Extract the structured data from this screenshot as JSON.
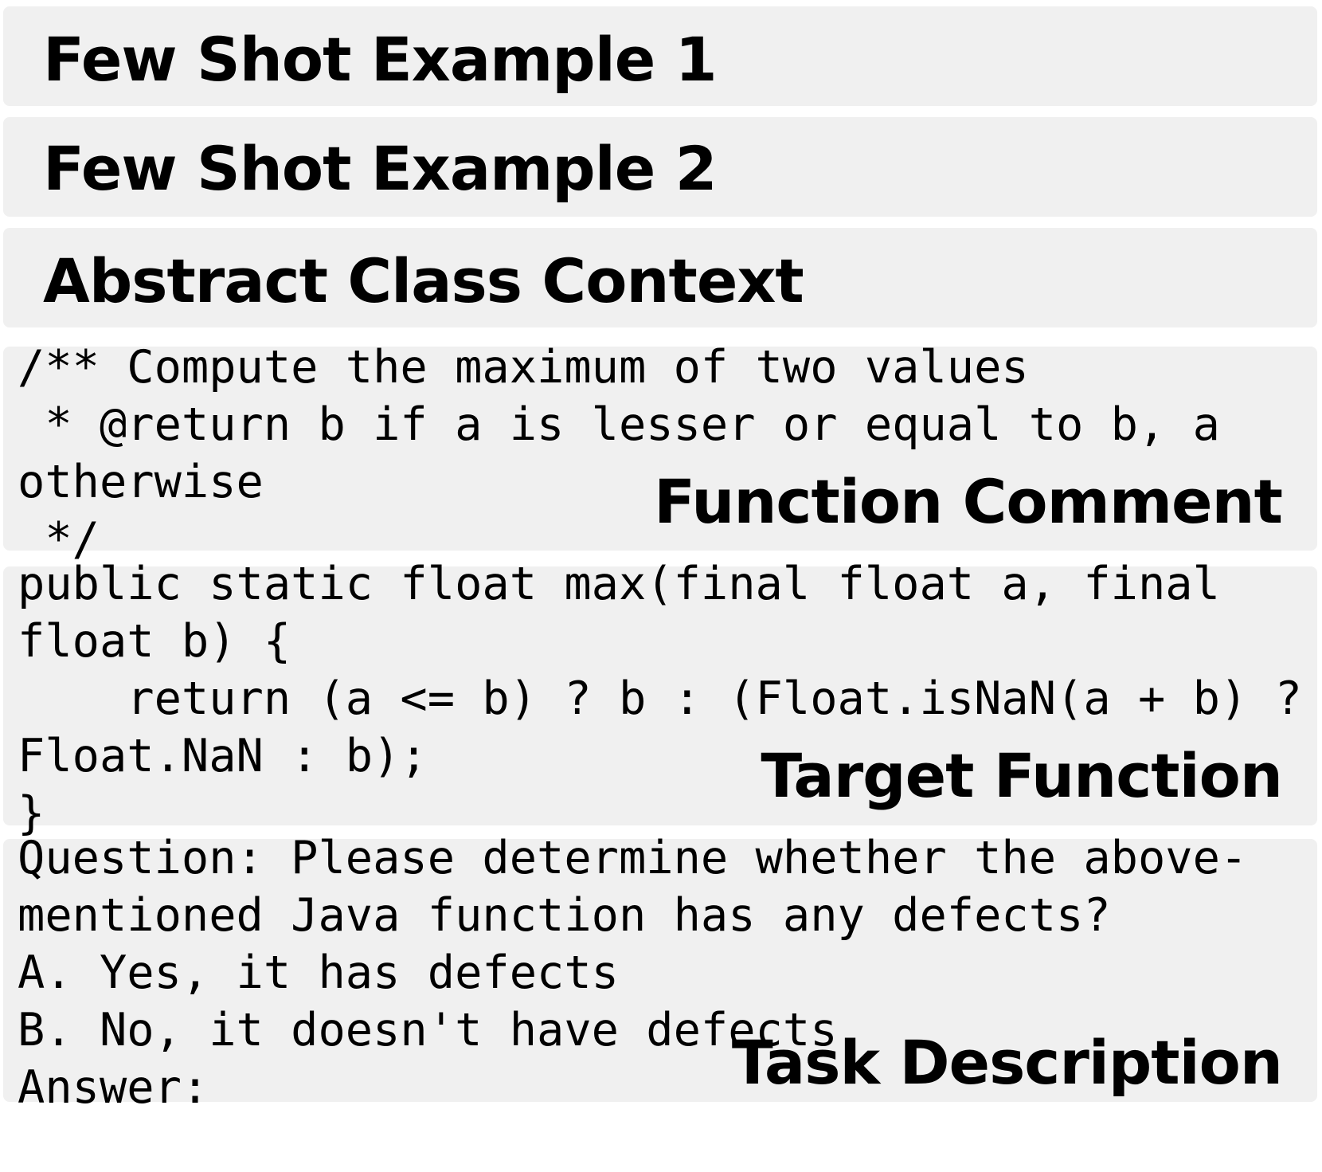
{
  "headers": [
    {
      "title": "Few Shot Example 1"
    },
    {
      "title": "Few Shot Example 2"
    },
    {
      "title": "Abstract Class Context"
    }
  ],
  "function_comment": {
    "label": "Function Comment",
    "lines": [
      "/** Compute the maximum of two values",
      " * @return b if a is lesser or equal to b, a",
      "otherwise",
      " */"
    ]
  },
  "target_function": {
    "label": "Target Function",
    "lines": [
      "public static float max(final float a, final",
      "float b) {",
      "    return (a <= b) ? b : (Float.isNaN(a + b) ?",
      "Float.NaN : b);",
      "}"
    ]
  },
  "task_description": {
    "label": "Task Description",
    "lines": [
      "Question: Please determine whether the above-",
      "mentioned Java function has any defects?",
      "A. Yes, it has defects",
      "B. No, it doesn't have defects",
      "Answer:"
    ]
  }
}
